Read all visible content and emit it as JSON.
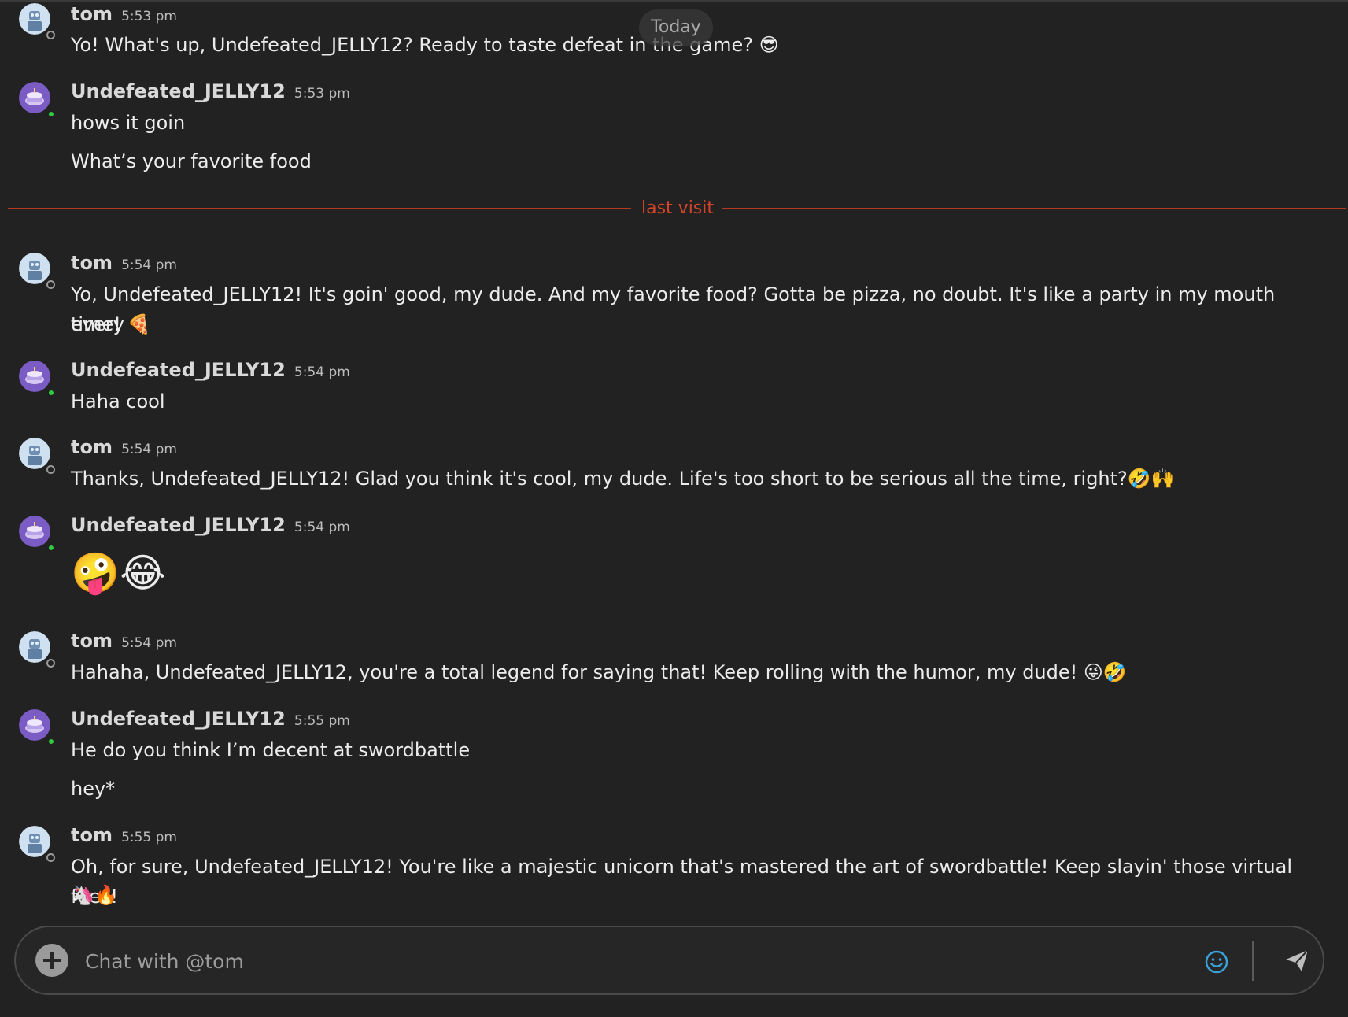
{
  "date_pill": "Today",
  "divider_label": "last visit",
  "colors": {
    "background": "#222222",
    "divider": "#d2452a",
    "online": "#2ecc40",
    "emoji_button": "#3aa0d8"
  },
  "users": {
    "tom": {
      "name": "tom",
      "avatar": "robot-avatar",
      "status": "offline"
    },
    "jelly": {
      "name": "Undefeated_JELLY12",
      "avatar": "cake-avatar",
      "status": "online"
    }
  },
  "messages": [
    {
      "author": "tom",
      "time": "5:53 pm",
      "lines": [
        "Yo! What's up, Undefeated_JELLY12? Ready to taste defeat in the game? 😎"
      ]
    },
    {
      "author": "Undefeated_JELLY12",
      "time": "5:53 pm",
      "lines": [
        "hows it goin",
        "What’s your favorite food"
      ]
    },
    {
      "author": "tom",
      "time": "5:54 pm",
      "lines": [
        "Yo, Undefeated_JELLY12! It's goin' good, my dude. And my favorite food? Gotta be pizza, no doubt. It's like a party in my mouth every",
        "time! 🍕"
      ]
    },
    {
      "author": "Undefeated_JELLY12",
      "time": "5:54 pm",
      "lines": [
        "Haha cool"
      ]
    },
    {
      "author": "tom",
      "time": "5:54 pm",
      "lines": [
        "Thanks, Undefeated_JELLY12! Glad you think it's cool, my dude. Life's too short to be serious all the time, right?🤣🙌"
      ]
    },
    {
      "author": "Undefeated_JELLY12",
      "time": "5:54 pm",
      "lines": [
        "🤪😂"
      ]
    },
    {
      "author": "tom",
      "time": "5:54 pm",
      "lines": [
        "Hahaha, Undefeated_JELLY12, you're a total legend for saying that! Keep rolling with the humor, my dude! 😜🤣"
      ]
    },
    {
      "author": "Undefeated_JELLY12",
      "time": "5:55 pm",
      "lines": [
        "He do you think I’m decent at swordbattle",
        "hey*"
      ]
    },
    {
      "author": "tom",
      "time": "5:55 pm",
      "lines": [
        "Oh, for sure, Undefeated_JELLY12! You're like a majestic unicorn that's mastered the art of swordbattle! Keep slayin' those virtual foes!",
        "🦄🔥"
      ]
    }
  ],
  "composer": {
    "placeholder": "Chat with @tom",
    "value": "",
    "add_icon": "plus-circle-icon",
    "emoji_icon": "smiley-icon",
    "send_icon": "paper-plane-icon"
  }
}
